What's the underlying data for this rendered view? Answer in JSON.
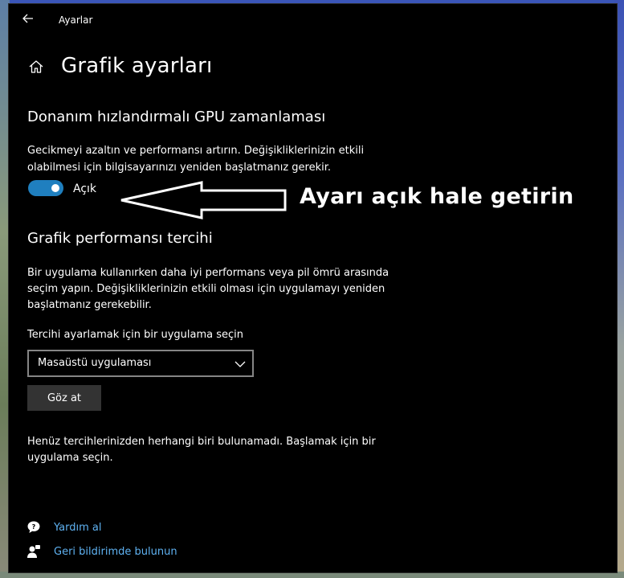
{
  "window": {
    "app_title": "Ayarlar",
    "back_icon": "back-arrow-icon",
    "page_title": "Grafik ayarları",
    "home_icon": "home-icon"
  },
  "gpu_section": {
    "title": "Donanım hızlandırmalı GPU zamanlaması",
    "description_line1": "Gecikmeyi azaltın ve performansı artırın. Değişikliklerinizin etkili",
    "description_line2": "olabilmesi için bilgisayarınızı yeniden başlatmanız gerekir.",
    "toggle_state": "on",
    "toggle_label": "Açık"
  },
  "annotation": {
    "text": "Ayarı açık hale getirin"
  },
  "perf_section": {
    "title": "Grafik performansı tercihi",
    "description_line1": "Bir uygulama kullanırken daha iyi performans veya pil ömrü arasında",
    "description_line2": "seçim yapın. Değişikliklerinizin etkili olması için uygulamayı yeniden",
    "description_line3": "başlatmanız gerekebilir.",
    "select_label": "Tercihi ayarlamak için bir uygulama seçin",
    "dropdown_value": "Masaüstü uygulaması",
    "browse_label": "Göz at",
    "empty_line1": "Henüz tercihlerinizden herhangi biri bulunamadı. Başlamak için bir",
    "empty_line2": "uygulama seçin."
  },
  "links": {
    "help_label": "Yardım al",
    "feedback_label": "Geri bildirimde bulunun"
  },
  "colors": {
    "accent": "#1f7fbf",
    "link": "#5fb2f2",
    "background": "#000000"
  }
}
